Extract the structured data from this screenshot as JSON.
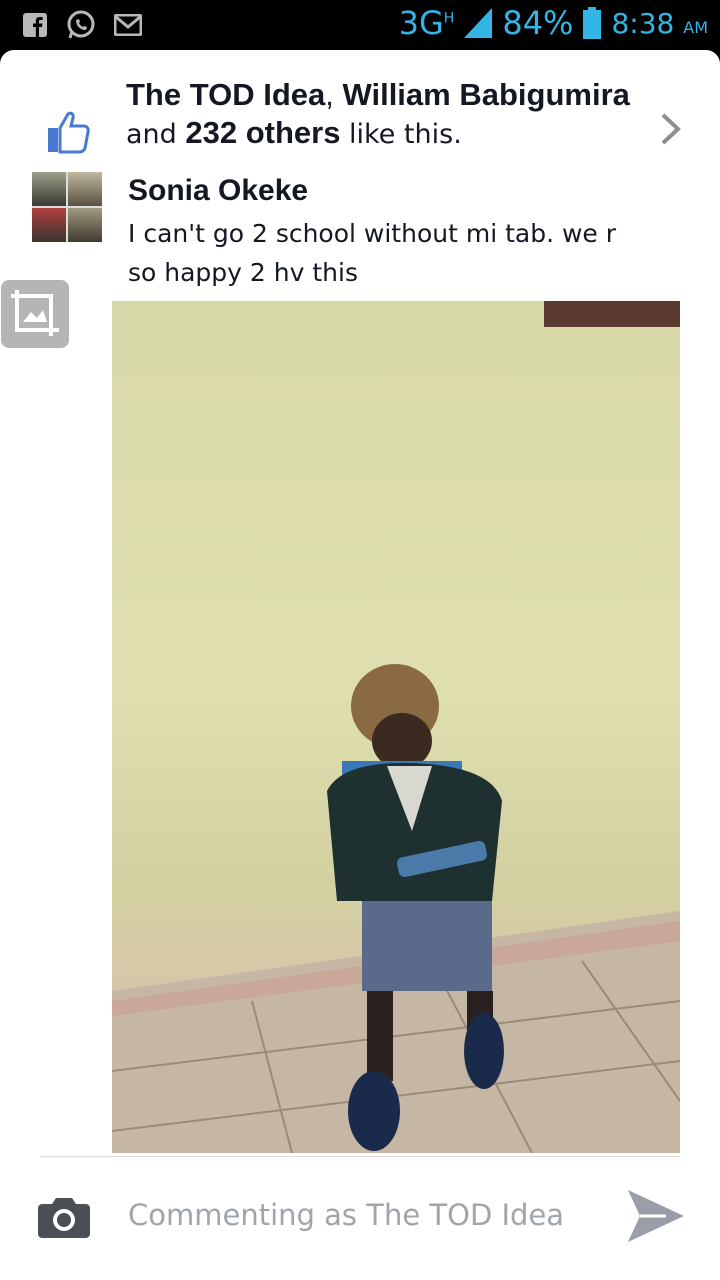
{
  "status_bar": {
    "network": "3G",
    "network_sup": "H",
    "battery": "84%",
    "time": "8:38",
    "ampm": "AM",
    "icons": [
      "facebook-icon",
      "whatsapp-icon",
      "gmail-icon",
      "signal-icon",
      "battery-icon"
    ]
  },
  "likes": {
    "name1": "The TOD Idea",
    "sep": ", ",
    "name2": "William Babigumira",
    "and": "and ",
    "others": "232 others",
    "tail": " like this."
  },
  "comment": {
    "author": "Sonia Okeke",
    "text": "I can't go 2 school without mi tab. we r so happy 2 hv this"
  },
  "composer": {
    "placeholder": "Commenting as The TOD Idea"
  },
  "colors": {
    "status_accent": "#33b5e5",
    "facebook_blue": "#4a7ad0",
    "send_gray": "#9a9ea6"
  }
}
